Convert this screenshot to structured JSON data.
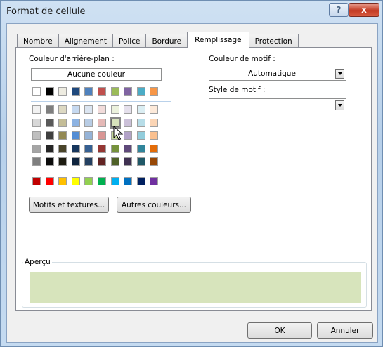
{
  "window": {
    "title": "Format de cellule",
    "help_label": "?",
    "close_label": "x"
  },
  "tabs": [
    "Nombre",
    "Alignement",
    "Police",
    "Bordure",
    "Remplissage",
    "Protection"
  ],
  "active_tab": "Remplissage",
  "background": {
    "label": "Couleur d'arrière-plan :",
    "no_color_label": "Aucune couleur",
    "theme_colors": [
      "#ffffff",
      "#000000",
      "#eeece1",
      "#1f497d",
      "#4f81bd",
      "#c0504d",
      "#9bbb59",
      "#8064a2",
      "#4bacc6",
      "#f79646"
    ],
    "theme_shades": [
      [
        "#f2f2f2",
        "#7f7f7f",
        "#ddd9c3",
        "#c6d9f0",
        "#dbe5f1",
        "#f2dcdb",
        "#ebf1dd",
        "#e5e0ec",
        "#dbeef3",
        "#fdeada"
      ],
      [
        "#d8d8d8",
        "#595959",
        "#c4bd97",
        "#8db3e2",
        "#b8cce4",
        "#e5b9b7",
        "#d7e3bc",
        "#ccc1d9",
        "#b7dde8",
        "#fbd5b5"
      ],
      [
        "#bfbfbf",
        "#3f3f3f",
        "#938953",
        "#548dd4",
        "#95b3d7",
        "#d99694",
        "#c3d69b",
        "#b2a2c7",
        "#92cddc",
        "#fac08f"
      ],
      [
        "#a5a5a5",
        "#262626",
        "#494429",
        "#17365d",
        "#366092",
        "#953734",
        "#76923c",
        "#5f497a",
        "#31859b",
        "#e36c09"
      ],
      [
        "#7f7f7f",
        "#0c0c0c",
        "#1d1b10",
        "#0f243e",
        "#244061",
        "#632423",
        "#4f6128",
        "#3f3151",
        "#205867",
        "#974806"
      ]
    ],
    "standard_colors": [
      "#c00000",
      "#ff0000",
      "#ffc000",
      "#ffff00",
      "#92d050",
      "#00b050",
      "#00b0f0",
      "#0070c0",
      "#002060",
      "#7030a0"
    ],
    "selected_color": "#d8e4bc",
    "selected_swatch": "shades-row1-col6"
  },
  "buttons": {
    "patterns": "Motifs et textures...",
    "more_colors": "Autres couleurs...",
    "ok": "OK",
    "cancel": "Annuler"
  },
  "pattern": {
    "color_label": "Couleur de motif :",
    "color_value": "Automatique",
    "style_label": "Style de motif :",
    "style_value": ""
  },
  "preview": {
    "label": "Aperçu",
    "color": "#d7e4bc"
  }
}
